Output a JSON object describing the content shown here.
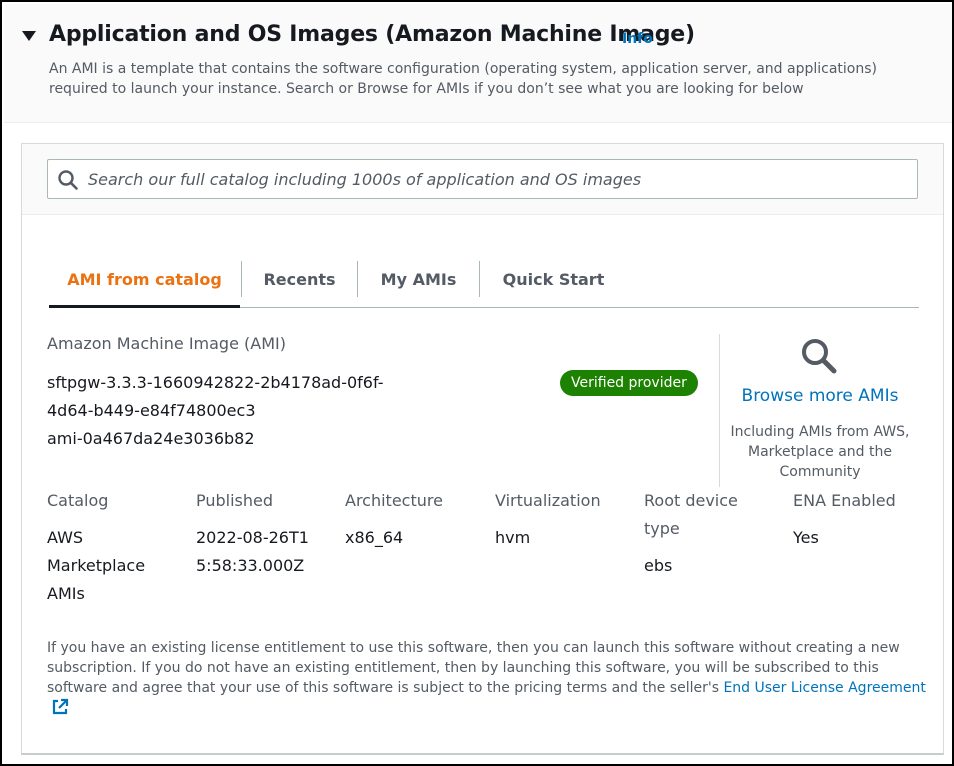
{
  "header": {
    "title": "Application and OS Images (Amazon Machine Image)",
    "info_label": "Info",
    "description": "An AMI is a template that contains the software configuration (operating system, application server, and applications) required to launch your instance. Search or Browse for AMIs if you don’t see what you are looking for below"
  },
  "search": {
    "placeholder": "Search our full catalog including 1000s of application and OS images",
    "icon": "search-icon"
  },
  "tabs": [
    {
      "label": "AMI from catalog",
      "active": true
    },
    {
      "label": "Recents",
      "active": false
    },
    {
      "label": "My AMIs",
      "active": false
    },
    {
      "label": "Quick Start",
      "active": false
    }
  ],
  "ami": {
    "section_label": "Amazon Machine Image (AMI)",
    "name_line1": "sftpgw-3.3.3-1660942822-2b4178ad-0f6f-",
    "name_line2": "4d64-b449-e84f74800ec3",
    "id": "ami-0a467da24e3036b82",
    "badge": "Verified provider",
    "badge_color": "#1d8102"
  },
  "browse": {
    "icon": "magnifier-icon",
    "link_label": "Browse more AMIs",
    "subtext": "Including AMIs from AWS, Marketplace and the Community"
  },
  "details": {
    "catalog": {
      "label": "Catalog",
      "value": "AWS Marketplace AMIs"
    },
    "published": {
      "label": "Published",
      "value": "2022-08-26T15:58:33.000Z"
    },
    "architecture": {
      "label": "Architecture",
      "value": "x86_64"
    },
    "virtualization": {
      "label": "Virtualization",
      "value": "hvm"
    },
    "root_device": {
      "label": "Root device type",
      "value": "ebs"
    },
    "ena": {
      "label": "ENA Enabled",
      "value": "Yes"
    }
  },
  "license": {
    "text": "If you have an existing license entitlement to use this software, then you can launch this software without creating a new subscription. If you do not have an existing entitlement, then by launching this software, you will be subscribed to this software and agree that your use of this software is subject to the pricing terms and the seller's ",
    "link_label": "End User License Agreement",
    "link_icon": "external-link-icon"
  },
  "colors": {
    "link": "#0073bb",
    "active_tab": "#ec7211",
    "text_secondary": "#545b64"
  }
}
